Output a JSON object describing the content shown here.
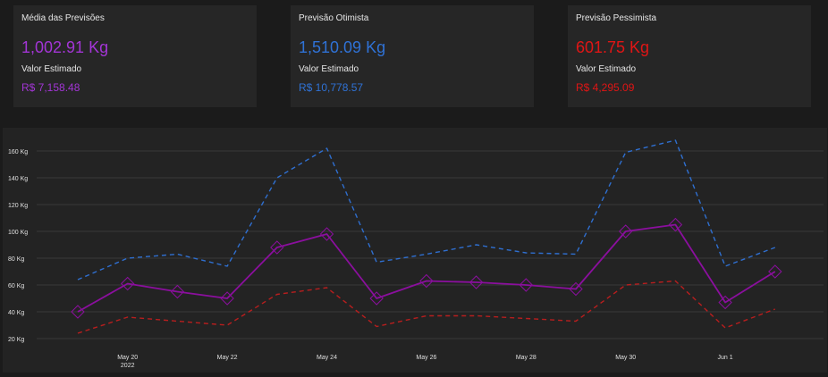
{
  "cards": [
    {
      "title": "Média das Previsões",
      "weight": "1,002.91 Kg",
      "subtitle": "Valor Estimado",
      "money": "R$ 7,158.48",
      "color": "#a335d6"
    },
    {
      "title": "Previsão Otimista",
      "weight": "1,510.09 Kg",
      "subtitle": "Valor Estimado",
      "money": "R$ 10,778.57",
      "color": "#2f72d6"
    },
    {
      "title": "Previsão Pessimista",
      "weight": "601.75 Kg",
      "subtitle": "Valor Estimado",
      "money": "R$ 4,295.09",
      "color": "#e01515"
    }
  ],
  "chart_data": {
    "type": "line",
    "title": "",
    "xlabel": "",
    "ylabel": "",
    "x": [
      "2022-05-19",
      "2022-05-20",
      "2022-05-21",
      "2022-05-22",
      "2022-05-23",
      "2022-05-24",
      "2022-05-25",
      "2022-05-26",
      "2022-05-27",
      "2022-05-28",
      "2022-05-29",
      "2022-05-30",
      "2022-05-31",
      "2022-06-01",
      "2022-06-02"
    ],
    "x_tick_labels": [
      "May 20",
      "May 22",
      "May 24",
      "May 26",
      "May 28",
      "May 30",
      "Jun 1"
    ],
    "x_tick_dates": [
      "2022-05-20",
      "2022-05-22",
      "2022-05-24",
      "2022-05-26",
      "2022-05-28",
      "2022-05-30",
      "2022-06-01"
    ],
    "x_year_label": "2022",
    "y_tick_labels": [
      "20 Kg",
      "40 Kg",
      "60 Kg",
      "80 Kg",
      "100 Kg",
      "120 Kg",
      "140 Kg",
      "160 Kg"
    ],
    "y_ticks": [
      20,
      40,
      60,
      80,
      100,
      120,
      140,
      160
    ],
    "ylim": [
      14,
      168
    ],
    "grid": true,
    "series": [
      {
        "values": [
          64,
          80,
          83,
          74,
          140,
          162,
          77,
          83,
          90,
          84,
          83,
          159,
          168,
          74,
          88
        ],
        "color": "#2f6fd0",
        "dash": true,
        "markers": false
      },
      {
        "values": [
          40,
          61,
          55,
          50,
          88,
          98,
          50,
          63,
          62,
          60,
          57,
          100,
          105,
          47,
          70
        ],
        "color": "#8b0f9e",
        "dash": false,
        "markers": true
      },
      {
        "values": [
          24,
          36,
          33,
          30,
          53,
          58,
          29,
          37,
          37,
          35,
          33,
          60,
          63,
          28,
          42
        ],
        "color": "#b81e1e",
        "dash": true,
        "markers": false
      }
    ]
  }
}
